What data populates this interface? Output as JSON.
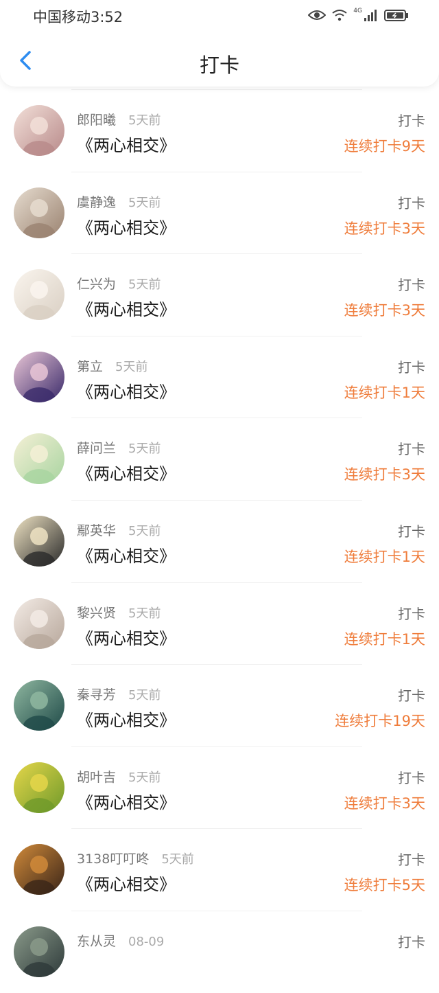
{
  "status_bar": {
    "carrier": "中国移动",
    "time": "3:52",
    "network_badge": "4G"
  },
  "header": {
    "title": "打卡",
    "back_icon": "chevron-left-icon",
    "accent_color": "#2d8cf0"
  },
  "streak_color": "#ef7d3c",
  "rows": [
    {
      "name": "郎阳曦",
      "time": "5天前",
      "book": "《两心相交》",
      "action": "打卡",
      "streak": "连续打卡9天",
      "avatar": {
        "a": "#b88a8a",
        "b": "#f2dfd8"
      }
    },
    {
      "name": "虞静逸",
      "time": "5天前",
      "book": "《两心相交》",
      "action": "打卡",
      "streak": "连续打卡3天",
      "avatar": {
        "a": "#9a8270",
        "b": "#e6dccf"
      }
    },
    {
      "name": "仁兴为",
      "time": "5天前",
      "book": "《两心相交》",
      "action": "打卡",
      "streak": "连续打卡3天",
      "avatar": {
        "a": "#d9cfc3",
        "b": "#faf5ee"
      }
    },
    {
      "name": "第立",
      "time": "5天前",
      "book": "《两心相交》",
      "action": "打卡",
      "streak": "连续打卡1天",
      "avatar": {
        "a": "#3a2a6a",
        "b": "#e9c6d6"
      }
    },
    {
      "name": "薛问兰",
      "time": "5天前",
      "book": "《两心相交》",
      "action": "打卡",
      "streak": "连续打卡3天",
      "avatar": {
        "a": "#a8d4a0",
        "b": "#f5f0d6"
      }
    },
    {
      "name": "鄢英华",
      "time": "5天前",
      "book": "《两心相交》",
      "action": "打卡",
      "streak": "连续打卡1天",
      "avatar": {
        "a": "#2a2a2a",
        "b": "#efe3c3"
      }
    },
    {
      "name": "黎兴贤",
      "time": "5天前",
      "book": "《两心相交》",
      "action": "打卡",
      "streak": "连续打卡1天",
      "avatar": {
        "a": "#b7a79b",
        "b": "#f3ebe5"
      }
    },
    {
      "name": "秦寻芳",
      "time": "5天前",
      "book": "《两心相交》",
      "action": "打卡",
      "streak": "连续打卡19天",
      "avatar": {
        "a": "#1f4a48",
        "b": "#8fb7a0"
      }
    },
    {
      "name": "胡叶吉",
      "time": "5天前",
      "book": "《两心相交》",
      "action": "打卡",
      "streak": "连续打卡3天",
      "avatar": {
        "a": "#6f9a2a",
        "b": "#e5d64a"
      }
    },
    {
      "name": "3138叮叮咚",
      "time": "5天前",
      "book": "《两心相交》",
      "action": "打卡",
      "streak": "连续打卡5天",
      "avatar": {
        "a": "#3a2518",
        "b": "#d08a3a"
      }
    },
    {
      "name": "东从灵",
      "time": "08-09",
      "book": "",
      "action": "打卡",
      "streak": "",
      "avatar": {
        "a": "#2e3a3a",
        "b": "#8a9a8a"
      }
    }
  ]
}
